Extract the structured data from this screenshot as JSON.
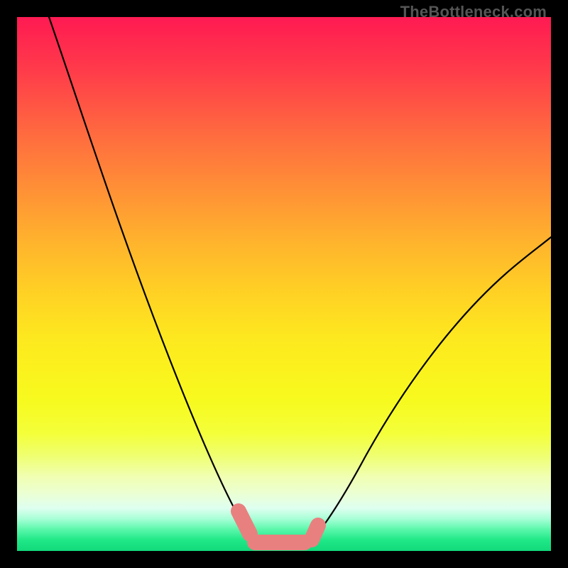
{
  "watermark": "TheBottleneck.com",
  "chart_data": {
    "type": "line",
    "title": "",
    "xlabel": "",
    "ylabel": "",
    "xlim": [
      0,
      100
    ],
    "ylim": [
      0,
      100
    ],
    "series": [
      {
        "name": "left-curve",
        "x": [
          6,
          10,
          15,
          20,
          25,
          30,
          35,
          38,
          41,
          43,
          44
        ],
        "values": [
          100,
          88,
          74,
          60,
          46,
          32,
          19,
          11,
          6,
          3,
          2
        ]
      },
      {
        "name": "right-curve",
        "x": [
          55,
          58,
          62,
          68,
          74,
          80,
          86,
          92,
          98,
          100
        ],
        "values": [
          2,
          4,
          8,
          15,
          24,
          33,
          42,
          50,
          57,
          60
        ]
      }
    ],
    "annotations": [
      {
        "name": "worm-marker",
        "x_range": [
          41,
          56
        ],
        "y": 2
      }
    ]
  }
}
